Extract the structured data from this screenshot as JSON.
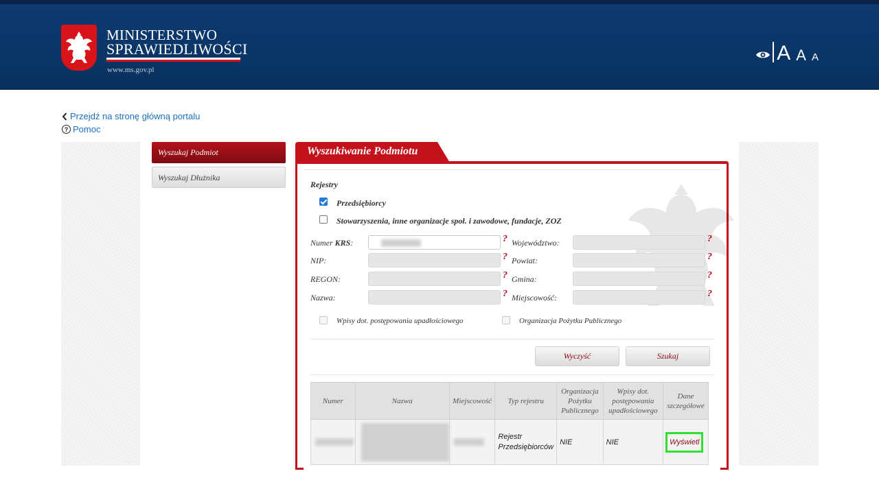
{
  "header": {
    "brand_line1": "MINISTERSTWO",
    "brand_line2": "SPRAWIEDLIWOŚCI",
    "brand_url": "www.ms.gov.pl",
    "font_large": "A",
    "font_medium": "A",
    "font_small": "A",
    "colors": {
      "header_bg": "#0a3566",
      "accent_red": "#c4121d"
    }
  },
  "nav": {
    "home_link": "Przejdź na stronę główną portalu",
    "help_link": "Pomoc",
    "help_icon": "?"
  },
  "sidebar": {
    "items": [
      {
        "label": "Wyszukaj Podmiot",
        "active": true
      },
      {
        "label": "Wyszukaj Dłużnika",
        "active": false
      }
    ]
  },
  "panel": {
    "title": "Wyszukiwanie Podmiotu",
    "registers_label": "Rejestry",
    "register_options": [
      {
        "label": "Przedsiębiorcy",
        "checked": true
      },
      {
        "label": "Stowarzyszenia, inne organizacje społ. i zawodowe, fundacje, ZOZ",
        "checked": false
      }
    ],
    "fields_left": [
      {
        "label_prefix": "Numer ",
        "label_bold": "KRS",
        "label_suffix": ":",
        "value": ""
      },
      {
        "label": "NIP:",
        "value": ""
      },
      {
        "label": "REGON:",
        "value": ""
      },
      {
        "label": "Nazwa:",
        "value": ""
      }
    ],
    "fields_right": [
      {
        "label": "Województwo:",
        "value": ""
      },
      {
        "label": "Powiat:",
        "value": ""
      },
      {
        "label": "Gmina:",
        "value": ""
      },
      {
        "label": "Miejscowość:",
        "value": ""
      }
    ],
    "help_mark": "?",
    "extra_options": [
      {
        "label": "Wpisy dot. postępowania upadłościowego",
        "checked": false
      },
      {
        "label": "Organizacja Pożytku Publicznego",
        "checked": false
      }
    ],
    "clear_button": "Wyczyść",
    "search_button": "Szukaj"
  },
  "results": {
    "columns": {
      "numer": "Numer",
      "nazwa": "Nazwa",
      "miejscowosc": "Miejscowość",
      "typ": "Typ rejestru",
      "opp_line1": "Organizacja",
      "opp_line2": "Pożytku",
      "opp_line3": "Publicznego",
      "wpisy_line1": "Wpisy dot.",
      "wpisy_line2": "postępowania",
      "wpisy_line3": "upadłościowego",
      "dane_line1": "Dane",
      "dane_line2": "szczegółowe"
    },
    "rows": [
      {
        "typ_line1": "Rejestr",
        "typ_line2": "Przedsiębiorców",
        "opp": "NIE",
        "wpisy": "NIE",
        "action": "Wyświetl"
      }
    ]
  }
}
